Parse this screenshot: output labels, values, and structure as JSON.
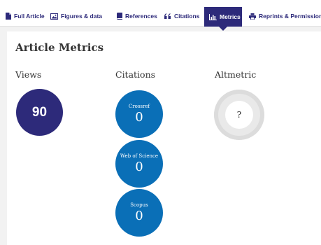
{
  "tabs": [
    {
      "label": "Full Article",
      "icon": "document-icon"
    },
    {
      "label": "Figures & data",
      "icon": "image-icon"
    },
    {
      "label": "References",
      "icon": "book-icon"
    },
    {
      "label": "Citations",
      "icon": "quote-icon"
    },
    {
      "label": "Metrics",
      "icon": "bar-chart-icon",
      "active": true
    },
    {
      "label": "Reprints & Permissions",
      "icon": "print-icon"
    }
  ],
  "metrics": {
    "heading": "Article Metrics",
    "views": {
      "title": "Views",
      "count": "90"
    },
    "citations": {
      "title": "Citations",
      "sources": [
        {
          "name": "Crossref",
          "count": "0"
        },
        {
          "name": "Web of Science",
          "count": "0"
        },
        {
          "name": "Scopus",
          "count": "0"
        }
      ]
    },
    "altmetric": {
      "title": "Altmetric",
      "score": "?"
    }
  },
  "colors": {
    "brand_navy": "#2d2a7a",
    "citation_blue": "#0a6fb7",
    "page_bg": "#f2f2f2",
    "text_dark": "#333333"
  }
}
